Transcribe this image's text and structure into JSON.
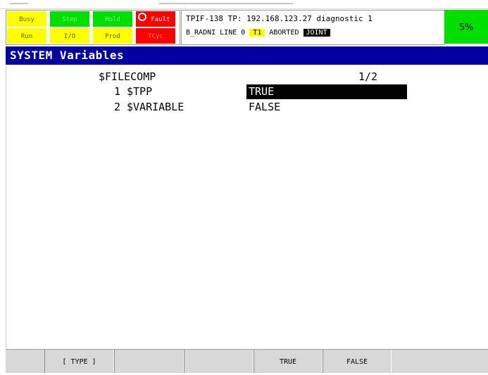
{
  "status_panel": {
    "indicators": [
      {
        "id": "busy",
        "label": "Busy",
        "bg": "#ffff00",
        "fg": "#606000"
      },
      {
        "id": "step",
        "label": "Step",
        "bg": "#00e000",
        "fg": "#80ff80"
      },
      {
        "id": "hold",
        "label": "Hold",
        "bg": "#00e000",
        "fg": "#80ff80"
      },
      {
        "id": "fault",
        "label": "Fault",
        "bg": "#ff0000",
        "fg": "#ffffff"
      },
      {
        "id": "run",
        "label": "Run",
        "bg": "#ffff00",
        "fg": "#606000"
      },
      {
        "id": "io",
        "label": "I/O",
        "bg": "#ffff00",
        "fg": "#606000"
      },
      {
        "id": "prod",
        "label": "Prod",
        "bg": "#ffff00",
        "fg": "#606000"
      },
      {
        "id": "tcyc",
        "label": "TCyc",
        "bg": "#ff0000",
        "fg": "#ff9090"
      }
    ]
  },
  "info_panel": {
    "line1": "TPIF-138 TP: 192.168.123.27 diagnostic 1",
    "program": "B_RADNI LINE 0",
    "mode_badge": "T1",
    "state": "ABORTED",
    "coord_badge": "JOINT"
  },
  "speed": {
    "value": "5%",
    "color": "#00e000"
  },
  "title_bar": {
    "title": "SYSTEM Variables",
    "color": "#0000a0"
  },
  "content": {
    "variable": "$FILECOMP",
    "page": "1/2",
    "rows": [
      {
        "index": "1",
        "name": "$TPP",
        "value": "TRUE"
      },
      {
        "index": "2",
        "name": "$VARIABLE",
        "value": "FALSE"
      }
    ]
  },
  "function_keys": {
    "f1": "[ TYPE ]",
    "f2": "",
    "f3": "",
    "f4": "TRUE",
    "f5": "FALSE"
  }
}
